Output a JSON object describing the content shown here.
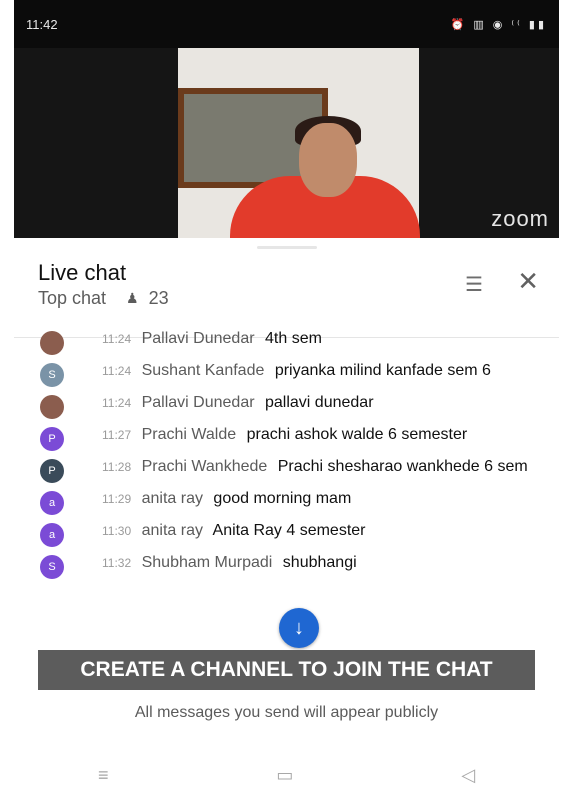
{
  "status_bar": {
    "time": "11:42",
    "icons": "⏰ ▥ ◉ ⁽⁽ ▮▮"
  },
  "video": {
    "brand": "zoom"
  },
  "chat": {
    "title": "Live chat",
    "mode_label": "Top chat",
    "viewer_icon": "people-icon",
    "viewer_count": "23",
    "filter_icon": "filter-icon",
    "close_icon": "close-icon"
  },
  "messages": [
    {
      "time": "11:24",
      "author": "Pallavi Dunedar",
      "text": "4th sem",
      "avatar_letter": "",
      "avatar_color": "#8b5d4e"
    },
    {
      "time": "11:24",
      "author": "Sushant Kanfade",
      "text": "priyanka milind kanfade sem 6",
      "avatar_letter": "S",
      "avatar_color": "#7a93a7"
    },
    {
      "time": "11:24",
      "author": "Pallavi Dunedar",
      "text": "pallavi dunedar",
      "avatar_letter": "",
      "avatar_color": "#8b5d4e"
    },
    {
      "time": "11:27",
      "author": "Prachi Walde",
      "text": "prachi ashok walde 6 semester",
      "avatar_letter": "P",
      "avatar_color": "#7b4bd6"
    },
    {
      "time": "11:28",
      "author": "Prachi Wankhede",
      "text": "Prachi shesharao wankhede 6 sem",
      "avatar_letter": "P",
      "avatar_color": "#3a4b5a"
    },
    {
      "time": "11:29",
      "author": "anita ray",
      "text": "good morning mam",
      "avatar_letter": "a",
      "avatar_color": "#7b4bd6"
    },
    {
      "time": "11:30",
      "author": "anita ray",
      "text": "Anita Ray 4 semester",
      "avatar_letter": "a",
      "avatar_color": "#7b4bd6"
    },
    {
      "time": "11:32",
      "author": "Shubham Murpadi",
      "text": "shubhangi",
      "avatar_letter": "S",
      "avatar_color": "#7b4bd6"
    }
  ],
  "scroll_button_icon": "arrow-down-icon",
  "cta": {
    "label": "CREATE A CHANNEL TO JOIN THE CHAT"
  },
  "public_note": "All messages you send will appear publicly",
  "nav": {
    "menu_icon": "≡",
    "home_icon": "▭",
    "back_icon": "◁"
  }
}
